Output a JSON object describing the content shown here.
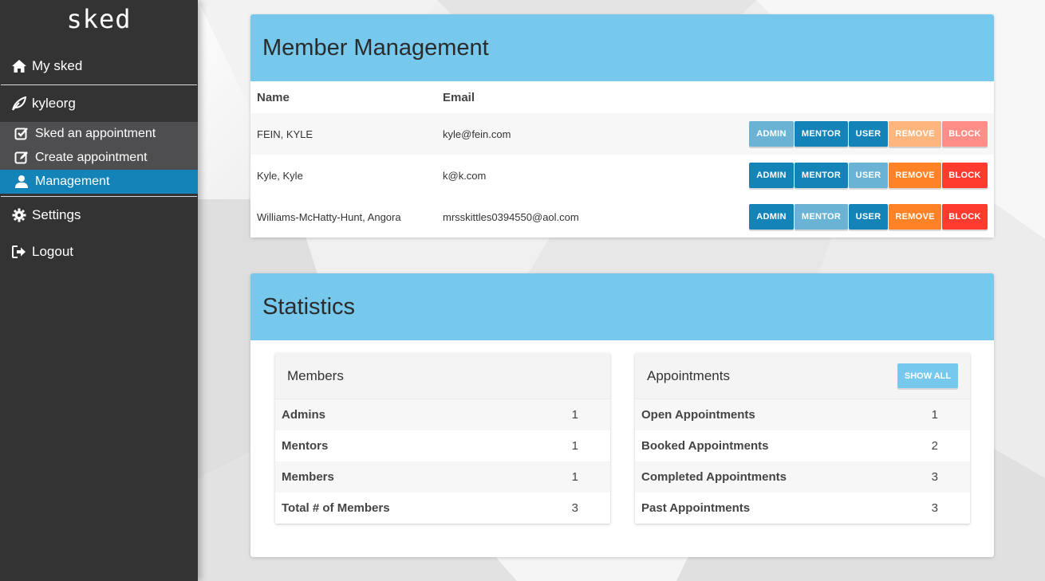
{
  "sidebar": {
    "brand": "sked",
    "items": {
      "my_sked": "My sked",
      "org": "kyleorg",
      "sked_appointment": "Sked an appointment",
      "create_appointment": "Create appointment",
      "management": "Management",
      "settings": "Settings",
      "logout": "Logout"
    }
  },
  "member_management": {
    "title": "Member Management",
    "columns": {
      "name": "Name",
      "email": "Email"
    },
    "button_labels": {
      "admin": "ADMIN",
      "mentor": "MENTOR",
      "user": "USER",
      "remove": "REMOVE",
      "block": "BLOCK"
    },
    "rows": [
      {
        "name": "FEIN, KYLE",
        "email": "kyle@fein.com"
      },
      {
        "name": "Kyle, Kyle",
        "email": "k@k.com"
      },
      {
        "name": "Williams-McHatty-Hunt, Angora",
        "email": "mrsskittles0394550@aol.com"
      }
    ]
  },
  "statistics": {
    "title": "Statistics",
    "members": {
      "header": "Members",
      "rows": [
        {
          "label": "Admins",
          "value": "1"
        },
        {
          "label": "Mentors",
          "value": "1"
        },
        {
          "label": "Members",
          "value": "1"
        },
        {
          "label": "Total # of Members",
          "value": "3"
        }
      ]
    },
    "appointments": {
      "header": "Appointments",
      "show_all": "SHOW ALL",
      "rows": [
        {
          "label": "Open Appointments",
          "value": "1"
        },
        {
          "label": "Booked Appointments",
          "value": "2"
        },
        {
          "label": "Completed Appointments",
          "value": "3"
        },
        {
          "label": "Past Appointments",
          "value": "3"
        }
      ]
    }
  },
  "colors": {
    "sidebar_bg": "#333333",
    "active_nav": "#1383b8",
    "panel_header": "#76c8ec",
    "button_blue": "#1383b8",
    "button_orange": "#ff8326",
    "button_red": "#ff3b30"
  }
}
